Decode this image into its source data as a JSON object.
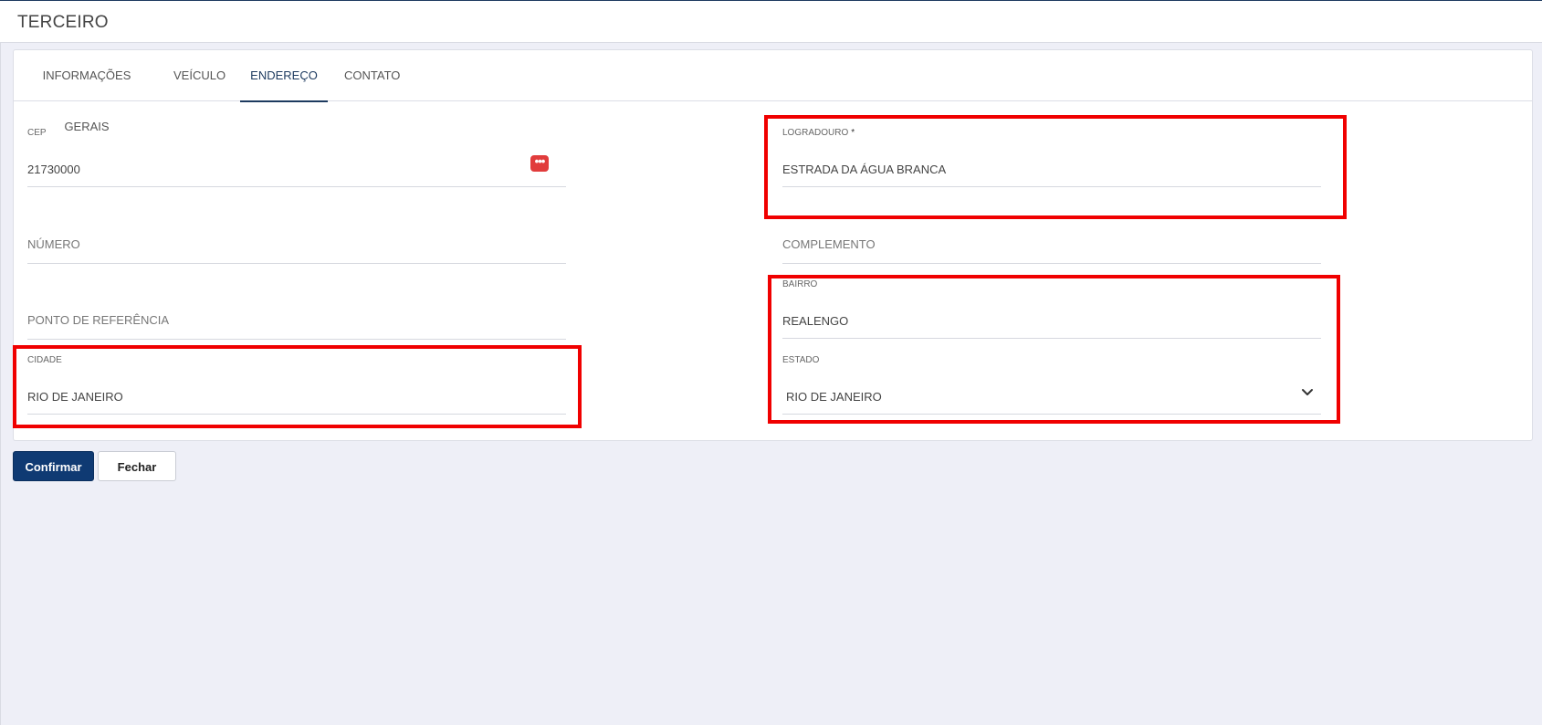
{
  "header": {
    "title": "TERCEIRO"
  },
  "tabs": [
    {
      "label": "INFORMAÇÕES GERAIS",
      "active": false
    },
    {
      "label": "VEÍCULO",
      "active": false
    },
    {
      "label": "ENDEREÇO",
      "active": true
    },
    {
      "label": "CONTATO",
      "active": false
    }
  ],
  "form": {
    "cep": {
      "label": "CEP",
      "value": "21730000",
      "search_icon": "ellipsis-icon"
    },
    "logradouro": {
      "label": "LOGRADOURO",
      "required_mark": "*",
      "value": "ESTRADA DA ÁGUA BRANCA"
    },
    "numero": {
      "placeholder": "NÚMERO"
    },
    "complemento": {
      "placeholder": "COMPLEMENTO"
    },
    "ponto_referencia": {
      "placeholder": "PONTO DE REFERÊNCIA"
    },
    "bairro": {
      "label": "BAIRRO",
      "value": "REALENGO"
    },
    "cidade": {
      "label": "CIDADE",
      "value": "RIO DE JANEIRO"
    },
    "estado": {
      "label": "ESTADO",
      "value": "RIO DE JANEIRO",
      "icon": "chevron-down-icon"
    }
  },
  "actions": {
    "confirm_label": "Confirmar",
    "close_label": "Fechar"
  },
  "colors": {
    "accent": "#0f3a73",
    "highlight": "#f00000",
    "cep_button": "#e13c3c",
    "background": "#eeeff7"
  }
}
